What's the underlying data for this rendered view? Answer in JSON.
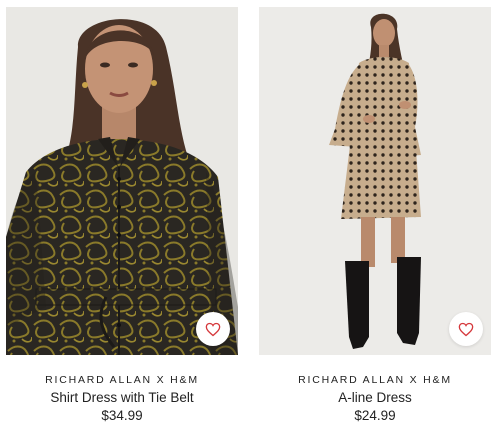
{
  "products": [
    {
      "brand": "RICHARD ALLAN X H&M",
      "name": "Shirt Dress with Tie Belt",
      "price": "$34.99",
      "image": "woman-in-black-print-shirt-dress",
      "favorite_icon": "heart-outline-icon"
    },
    {
      "brand": "RICHARD ALLAN X H&M",
      "name": "A-line Dress",
      "price": "$24.99",
      "image": "woman-in-beige-patterned-a-line-dress",
      "favorite_icon": "heart-outline-icon"
    }
  ],
  "colors": {
    "accent": "#d5383c",
    "text": "#222222",
    "photo_background": "#ececea"
  }
}
